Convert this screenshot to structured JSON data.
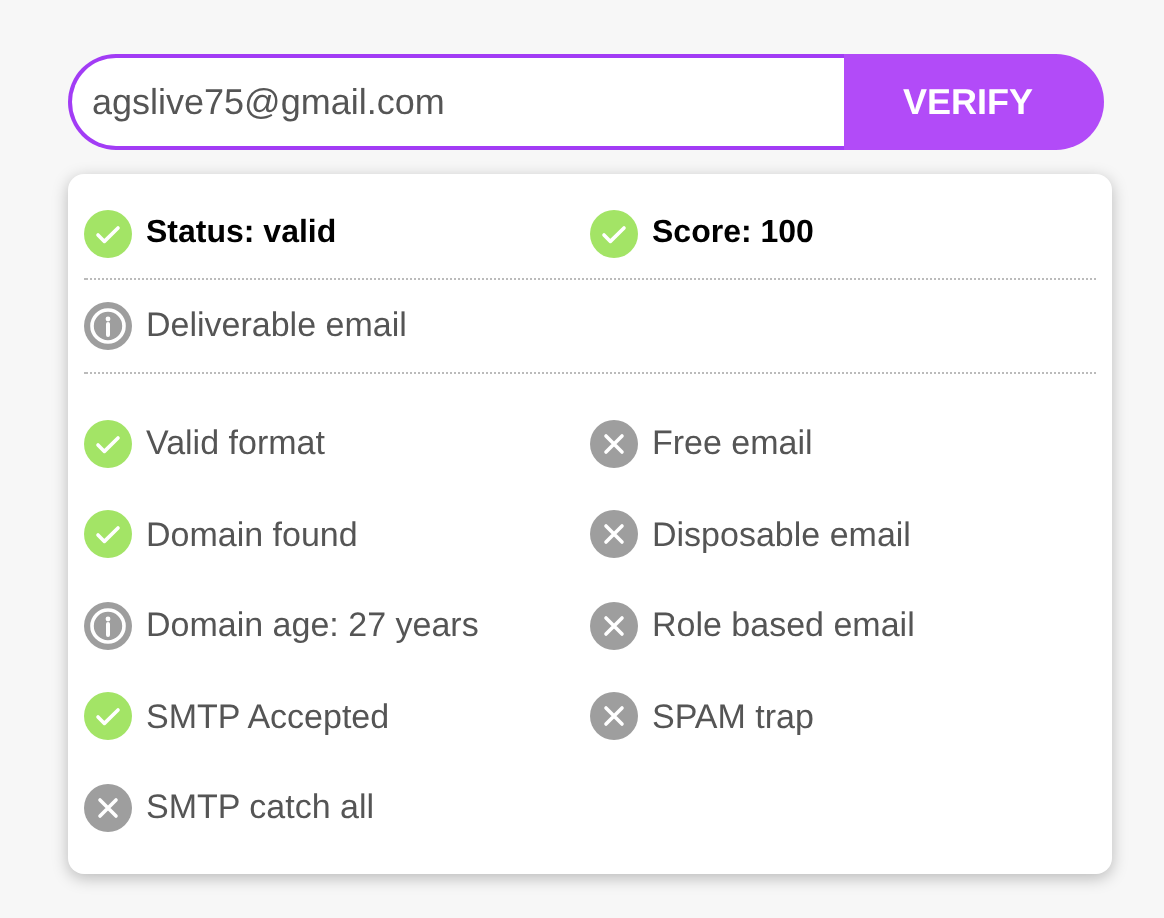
{
  "email_field": {
    "value": "agslive75@gmail.com"
  },
  "verify_button": {
    "label": "VERIFY"
  },
  "summary": [
    {
      "kind": "check",
      "label": "Status: valid"
    },
    {
      "kind": "check",
      "label": "Score: 100"
    }
  ],
  "note": {
    "kind": "info",
    "label": "Deliverable email"
  },
  "checks": [
    {
      "kind": "check",
      "label": "Valid format"
    },
    {
      "kind": "cross",
      "label": "Free email"
    },
    {
      "kind": "check",
      "label": "Domain found"
    },
    {
      "kind": "cross",
      "label": "Disposable email"
    },
    {
      "kind": "info",
      "label": "Domain age: 27 years"
    },
    {
      "kind": "cross",
      "label": "Role based email"
    },
    {
      "kind": "check",
      "label": "SMTP Accepted"
    },
    {
      "kind": "cross",
      "label": "SPAM trap"
    },
    {
      "kind": "cross",
      "label": "SMTP catch all"
    }
  ]
}
